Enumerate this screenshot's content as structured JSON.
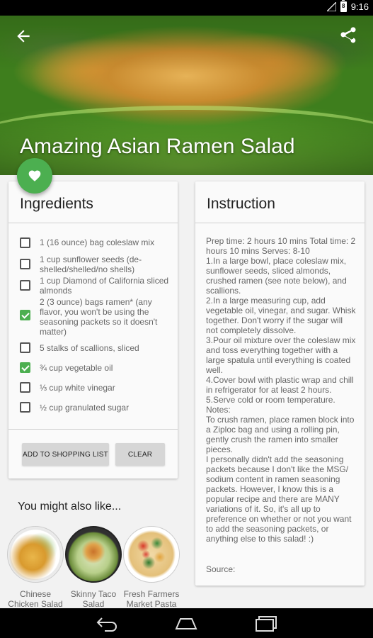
{
  "status_bar": {
    "time": "9:16",
    "battery": "8"
  },
  "header": {
    "title": "Amazing Asian Ramen Salad"
  },
  "icons": {
    "back": "arrow-back-icon",
    "share": "share-icon",
    "favorite": "heart-icon",
    "nav_back": "nav-back-icon",
    "nav_home": "nav-home-icon",
    "nav_recents": "nav-recents-icon"
  },
  "colors": {
    "accent": "#4caf50",
    "fab": "#4caf50"
  },
  "ingredients": {
    "title": "Ingredients",
    "items": [
      {
        "text": "1 (16 ounce) bag coleslaw mix",
        "checked": false
      },
      {
        "text": "1 cup sunflower seeds (de-shelled/shelled/no shells)",
        "checked": false
      },
      {
        "text": "1 cup Diamond of California sliced almonds",
        "checked": false
      },
      {
        "text": "2 (3 ounce) bags ramen* (any flavor, you won't be using the seasoning packets so it doesn't matter)",
        "checked": true
      },
      {
        "text": "5 stalks of scallions, sliced",
        "checked": false
      },
      {
        "text": "¾ cup vegetable oil",
        "checked": true
      },
      {
        "text": "⅓ cup white vinegar",
        "checked": false
      },
      {
        "text": "½ cup granulated sugar",
        "checked": false
      }
    ],
    "add_button": "ADD TO SHOPPING LIST",
    "clear_button": "CLEAR"
  },
  "instruction": {
    "title": "Instruction",
    "body": "Prep time: 2 hours 10 mins Total time: 2 hours 10 mins Serves: 8-10\n1.In a large bowl, place coleslaw mix, sunflower seeds, sliced almonds, crushed ramen (see note below), and scallions.\n2.In a large measuring cup, add vegetable oil, vinegar, and sugar. Whisk together. Don't worry if the sugar will not completely dissolve.\n3.Pour oil mixture over the coleslaw mix and toss everything together with a large spatula until everything is coated well.\n4.Cover bowl with plastic wrap and chill in refrigerator for at least 2 hours.\n5.Serve cold or room temperature.\nNotes:\nTo crush ramen, place ramen block into a Ziploc bag and using a rolling pin, gently crush the ramen into smaller pieces.\nI personally didn't add the seasoning packets because I don't like the MSG/ sodium content in ramen seasoning packets. However, I know this is a popular recipe and there are MANY variations of it. So, it's all up to preference on whether or not you want to add the seasoning packets, or anything else to this salad! :)",
    "source": "Source:"
  },
  "suggestions": {
    "title": "You might also like...",
    "items": [
      {
        "label": "Chinese Chicken Salad"
      },
      {
        "label": "Skinny Taco Salad"
      },
      {
        "label": "Fresh Farmers Market Pasta"
      }
    ]
  }
}
